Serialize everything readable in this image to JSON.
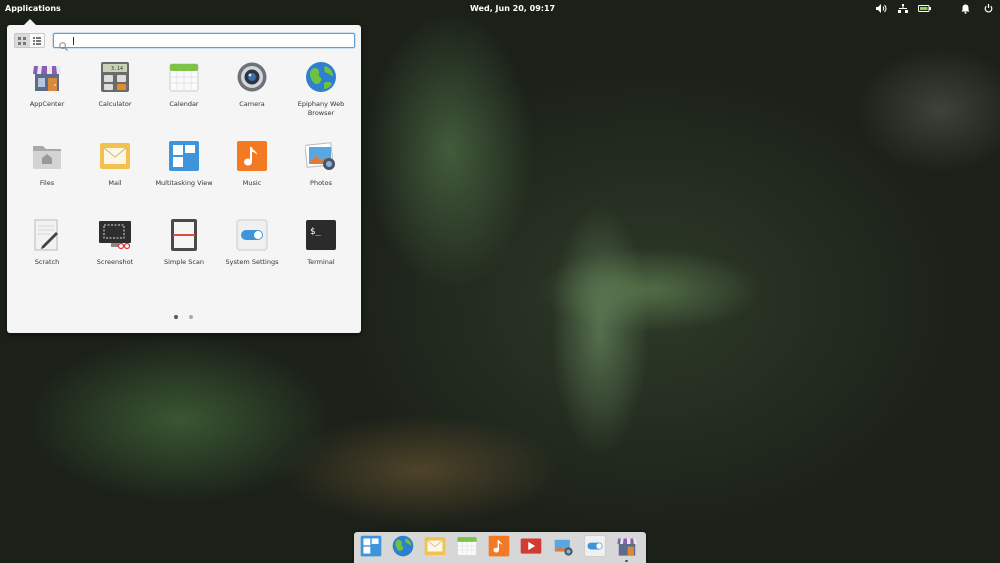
{
  "panel": {
    "applications_label": "Applications",
    "clock": "Wed, Jun 20, 09:17",
    "indicators": [
      "volume-icon",
      "network-icon",
      "battery-icon",
      "notifications-icon",
      "power-icon"
    ]
  },
  "launcher": {
    "search_value": "",
    "view_modes": [
      "grid-view-icon",
      "category-view-icon"
    ],
    "apps": [
      {
        "label": "AppCenter",
        "icon": "appcenter-icon"
      },
      {
        "label": "Calculator",
        "icon": "calculator-icon",
        "display": "3.14"
      },
      {
        "label": "Calendar",
        "icon": "calendar-icon"
      },
      {
        "label": "Camera",
        "icon": "camera-icon"
      },
      {
        "label": "Epiphany Web Browser",
        "icon": "web-browser-icon"
      },
      {
        "label": "Files",
        "icon": "files-icon"
      },
      {
        "label": "Mail",
        "icon": "mail-icon"
      },
      {
        "label": "Multitasking View",
        "icon": "multitasking-icon"
      },
      {
        "label": "Music",
        "icon": "music-icon"
      },
      {
        "label": "Photos",
        "icon": "photos-icon"
      },
      {
        "label": "Scratch",
        "icon": "scratch-icon"
      },
      {
        "label": "Screenshot",
        "icon": "screenshot-icon"
      },
      {
        "label": "Simple Scan",
        "icon": "scanner-icon"
      },
      {
        "label": "System Settings",
        "icon": "settings-icon"
      },
      {
        "label": "Terminal",
        "icon": "terminal-icon",
        "prompt": "$_"
      }
    ],
    "pages": 2,
    "current_page": 1
  },
  "dock": {
    "items": [
      "multitasking-icon",
      "web-browser-icon",
      "mail-icon",
      "calendar-icon",
      "music-icon",
      "videos-icon",
      "photos-icon",
      "settings-icon",
      "appcenter-icon"
    ]
  }
}
